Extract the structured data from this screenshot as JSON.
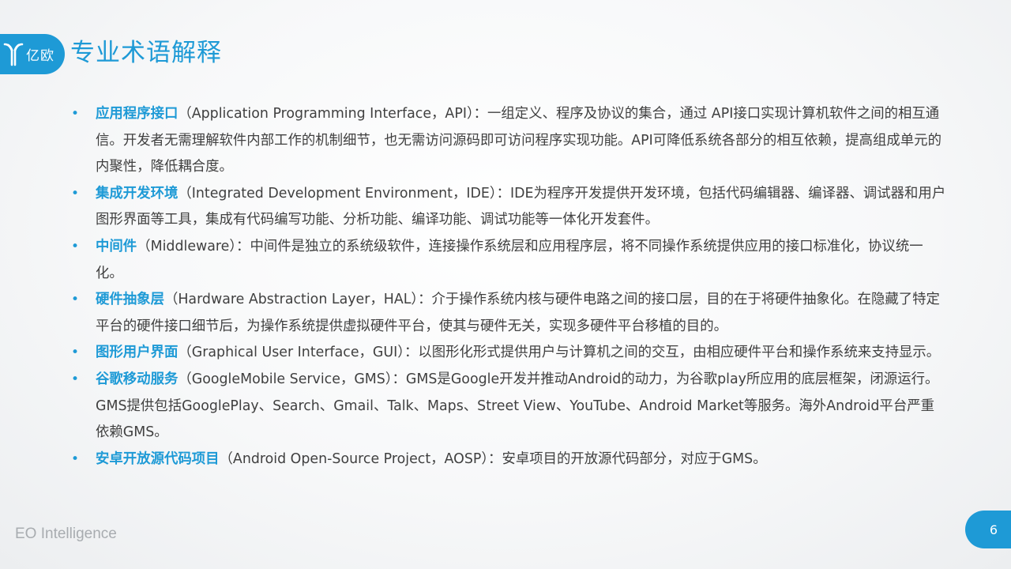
{
  "header": {
    "logo_text": "亿欧",
    "title": "专业术语解释"
  },
  "terms": [
    {
      "bullet": "•",
      "name": "应用程序接口",
      "desc": "（Application Programming Interface，API）：一组定义、程序及协议的集合，通过 API接口实现计算机软件之间的相互通信。开发者无需理解软件内部工作的机制细节，也无需访问源码即可访问程序实现功能。API可降低系统各部分的相互依赖，提高组成单元的内聚性，降低耦合度。"
    },
    {
      "bullet": "•",
      "name": "集成开发环境",
      "desc": "（Integrated Development Environment，IDE）：IDE为程序开发提供开发环境，包括代码编辑器、编译器、调试器和用户图形界面等工具，集成有代码编写功能、分析功能、编译功能、调试功能等一体化开发套件。"
    },
    {
      "bullet": "•",
      "name": "中间件",
      "desc": "（Middleware）：中间件是独立的系统级软件，连接操作系统层和应用程序层，将不同操作系统提供应用的接口标准化，协议统一化。"
    },
    {
      "bullet": "•",
      "name": "硬件抽象层",
      "desc": "（Hardware Abstraction Layer，HAL）：介于操作系统内核与硬件电路之间的接口层，目的在于将硬件抽象化。在隐藏了特定平台的硬件接口细节后，为操作系统提供虚拟硬件平台，使其与硬件无关，实现多硬件平台移植的目的。"
    },
    {
      "bullet": "•",
      "name": "图形用户界面",
      "desc": "（Graphical User Interface，GUI）：以图形化形式提供用户与计算机之间的交互，由相应硬件平台和操作系统来支持显示。"
    },
    {
      "bullet": "•",
      "name": "谷歌移动服务",
      "desc": "（GoogleMobile Service，GMS）：GMS是Google开发并推动Android的动力，为谷歌play所应用的底层框架，闭源运行。GMS提供包括GooglePlay、Search、Gmail、Talk、Maps、Street View、YouTube、Android Market等服务。海外Android平台严重依赖GMS。"
    },
    {
      "bullet": "•",
      "name": "安卓开放源代码项目",
      "desc": "（Android Open-Source Project，AOSP）：安卓项目的开放源代码部分，对应于GMS。"
    }
  ],
  "footer": {
    "brand": "EO Intelligence",
    "page_number": "6"
  },
  "colors": {
    "accent": "#1e9ad6",
    "body_text": "#404040",
    "brand_text": "#a8acb0"
  }
}
